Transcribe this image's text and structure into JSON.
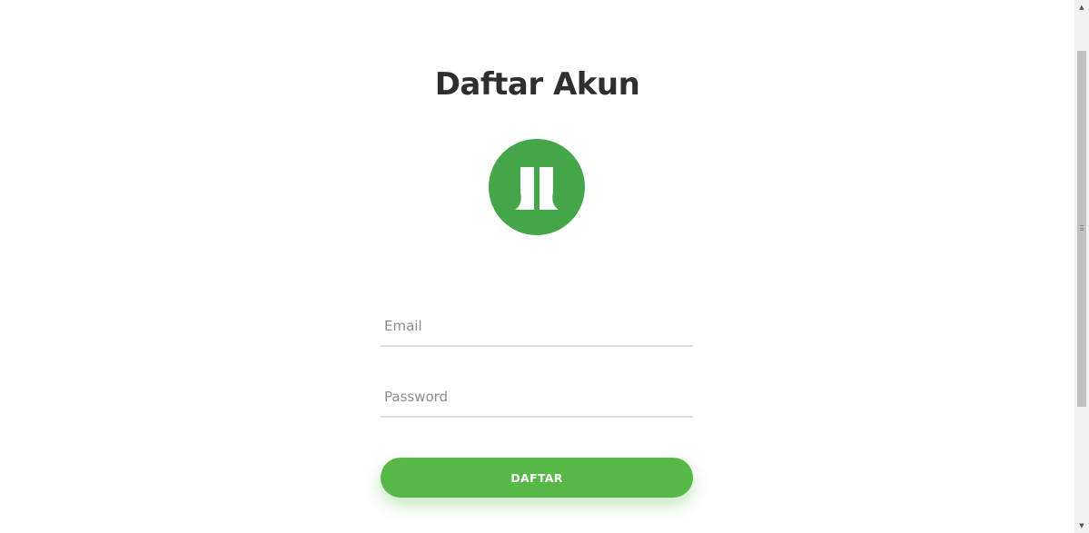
{
  "page": {
    "title": "Daftar Akun"
  },
  "logo": {
    "icon": "jl-logo-icon",
    "color": "#45a649"
  },
  "form": {
    "email_placeholder": "Email",
    "email_value": "",
    "password_placeholder": "Password",
    "password_value": "",
    "submit_label": "DAFTAR"
  },
  "colors": {
    "button": "#58b847",
    "logo": "#45a649",
    "title": "#2f2f2f",
    "underline": "#dedede"
  },
  "scrollbar": {
    "up_icon": "triangle-up-icon",
    "down_icon": "triangle-down-icon"
  }
}
